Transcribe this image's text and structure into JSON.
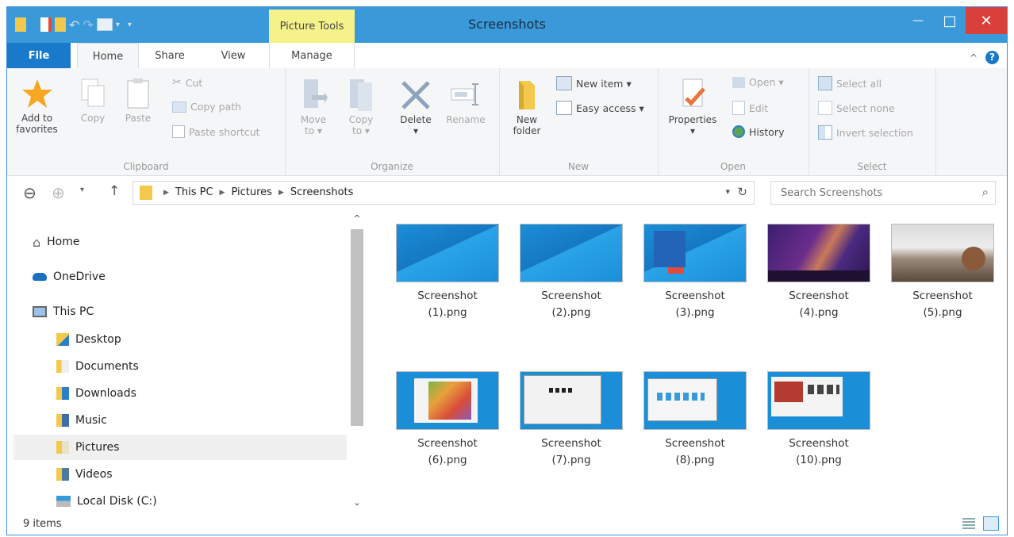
{
  "window": {
    "title": "Screenshots",
    "context_tab": "Picture Tools",
    "colors": {
      "titlebar": "#3a9ad9",
      "file_tab": "#1979ca",
      "context_tab": "#f5f28a",
      "close": "#d9403a"
    },
    "buttons": {
      "minimize": "—",
      "maximize": "□",
      "close": "✕"
    }
  },
  "tabs": [
    "File",
    "Home",
    "Share",
    "View",
    "Manage"
  ],
  "help": {
    "collapse": "^",
    "help": "?"
  },
  "ribbon": {
    "clipboard": {
      "label": "Clipboard",
      "add_to_favorites": "Add to\nfavorites",
      "copy": "Copy",
      "paste": "Paste",
      "cut": "Cut",
      "copy_path": "Copy path",
      "paste_shortcut": "Paste shortcut"
    },
    "organize": {
      "label": "Organize",
      "move_to": "Move\nto ▾",
      "copy_to": "Copy\nto ▾",
      "delete": "Delete\n▾",
      "rename": "Rename"
    },
    "new": {
      "label": "New",
      "new_folder": "New\nfolder",
      "new_item": "New item ▾",
      "easy_access": "Easy access ▾"
    },
    "open": {
      "label": "Open",
      "properties": "Properties\n▾",
      "open": "Open ▾",
      "edit": "Edit",
      "history": "History"
    },
    "select": {
      "label": "Select",
      "select_all": "Select all",
      "select_none": "Select none",
      "invert_selection": "Invert selection"
    }
  },
  "address": {
    "crumbs": [
      "This PC",
      "Pictures",
      "Screenshots"
    ],
    "search_placeholder": "Search Screenshots"
  },
  "nav": {
    "items": [
      {
        "label": "Home",
        "icon": "home-icon"
      },
      {
        "label": "OneDrive",
        "icon": "onedrive-icon"
      },
      {
        "label": "This PC",
        "icon": "computer-icon"
      },
      {
        "label": "Desktop",
        "icon": "desktop-folder-icon"
      },
      {
        "label": "Documents",
        "icon": "documents-folder-icon"
      },
      {
        "label": "Downloads",
        "icon": "downloads-folder-icon"
      },
      {
        "label": "Music",
        "icon": "music-folder-icon"
      },
      {
        "label": "Pictures",
        "icon": "pictures-folder-icon",
        "selected": true
      },
      {
        "label": "Videos",
        "icon": "videos-folder-icon"
      },
      {
        "label": "Local Disk (C:)",
        "icon": "local-disk-icon"
      }
    ]
  },
  "files": [
    {
      "name_line1": "Screenshot",
      "name_line2": "(1).png"
    },
    {
      "name_line1": "Screenshot",
      "name_line2": "(2).png"
    },
    {
      "name_line1": "Screenshot",
      "name_line2": "(3).png"
    },
    {
      "name_line1": "Screenshot",
      "name_line2": "(4).png"
    },
    {
      "name_line1": "Screenshot",
      "name_line2": "(5).png"
    },
    {
      "name_line1": "Screenshot",
      "name_line2": "(6).png"
    },
    {
      "name_line1": "Screenshot",
      "name_line2": "(7).png"
    },
    {
      "name_line1": "Screenshot",
      "name_line2": "(8).png"
    },
    {
      "name_line1": "Screenshot",
      "name_line2": "(10).png"
    }
  ],
  "status": {
    "item_count": "9 items"
  }
}
